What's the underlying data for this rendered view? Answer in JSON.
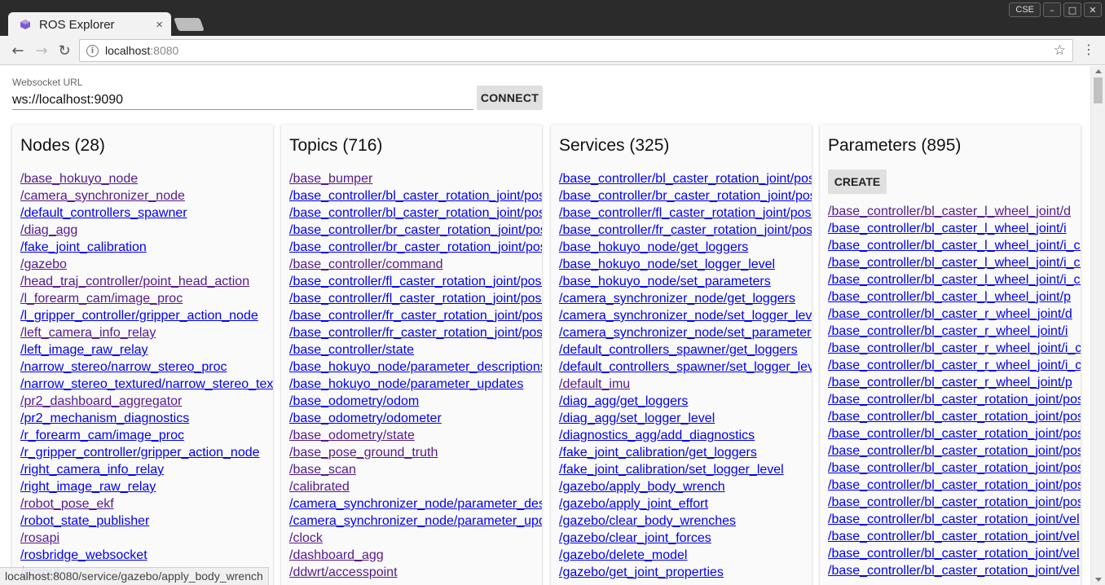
{
  "browser": {
    "tab_title": "ROS Explorer",
    "tab_close": "×",
    "win_cse": "CSE",
    "win_minimize": "–",
    "win_maximize": "□",
    "win_close": "✕",
    "url_host": "localhost",
    "url_port": ":8080",
    "back_icon": "←",
    "forward_icon": "→",
    "reload_icon": "↻",
    "info_icon": "i",
    "star_icon": "☆",
    "menu_icon": "⋮"
  },
  "websocket": {
    "label": "Websocket URL",
    "value": "ws://localhost:9090",
    "connect_label": "CONNECT"
  },
  "nodes": {
    "title": "Nodes (28)",
    "items": [
      {
        "text": "/base_hokuyo_node",
        "visited": true
      },
      {
        "text": "/camera_synchronizer_node",
        "visited": true
      },
      {
        "text": "/default_controllers_spawner",
        "visited": false
      },
      {
        "text": "/diag_agg",
        "visited": true
      },
      {
        "text": "/fake_joint_calibration",
        "visited": false
      },
      {
        "text": "/gazebo",
        "visited": true
      },
      {
        "text": "/head_traj_controller/point_head_action",
        "visited": true
      },
      {
        "text": "/l_forearm_cam/image_proc",
        "visited": true
      },
      {
        "text": "/l_gripper_controller/gripper_action_node",
        "visited": false
      },
      {
        "text": "/left_camera_info_relay",
        "visited": true
      },
      {
        "text": "/left_image_raw_relay",
        "visited": false
      },
      {
        "text": "/narrow_stereo/narrow_stereo_proc",
        "visited": false
      },
      {
        "text": "/narrow_stereo_textured/narrow_stereo_textured_proc",
        "visited": false
      },
      {
        "text": "/pr2_dashboard_aggregator",
        "visited": true
      },
      {
        "text": "/pr2_mechanism_diagnostics",
        "visited": false
      },
      {
        "text": "/r_forearm_cam/image_proc",
        "visited": false
      },
      {
        "text": "/r_gripper_controller/gripper_action_node",
        "visited": false
      },
      {
        "text": "/right_camera_info_relay",
        "visited": false
      },
      {
        "text": "/right_image_raw_relay",
        "visited": false
      },
      {
        "text": "/robot_pose_ekf",
        "visited": true
      },
      {
        "text": "/robot_state_publisher",
        "visited": false
      },
      {
        "text": "/rosapi",
        "visited": true
      },
      {
        "text": "/rosbridge_websocket",
        "visited": false
      },
      {
        "text": "/rosout",
        "visited": false
      }
    ]
  },
  "topics": {
    "title": "Topics (716)",
    "items": [
      {
        "text": "/base_bumper",
        "visited": true
      },
      {
        "text": "/base_controller/bl_caster_rotation_joint/pose",
        "visited": false
      },
      {
        "text": "/base_controller/bl_caster_rotation_joint/pose",
        "visited": false
      },
      {
        "text": "/base_controller/br_caster_rotation_joint/pose",
        "visited": false
      },
      {
        "text": "/base_controller/br_caster_rotation_joint/pose",
        "visited": false
      },
      {
        "text": "/base_controller/command",
        "visited": true
      },
      {
        "text": "/base_controller/fl_caster_rotation_joint/pose",
        "visited": false
      },
      {
        "text": "/base_controller/fl_caster_rotation_joint/pose",
        "visited": false
      },
      {
        "text": "/base_controller/fr_caster_rotation_joint/pose",
        "visited": false
      },
      {
        "text": "/base_controller/fr_caster_rotation_joint/pose",
        "visited": false
      },
      {
        "text": "/base_controller/state",
        "visited": false
      },
      {
        "text": "/base_hokuyo_node/parameter_descriptions",
        "visited": false
      },
      {
        "text": "/base_hokuyo_node/parameter_updates",
        "visited": false
      },
      {
        "text": "/base_odometry/odom",
        "visited": false
      },
      {
        "text": "/base_odometry/odometer",
        "visited": false
      },
      {
        "text": "/base_odometry/state",
        "visited": true
      },
      {
        "text": "/base_pose_ground_truth",
        "visited": true
      },
      {
        "text": "/base_scan",
        "visited": true
      },
      {
        "text": "/calibrated",
        "visited": true
      },
      {
        "text": "/camera_synchronizer_node/parameter_descriptions",
        "visited": false
      },
      {
        "text": "/camera_synchronizer_node/parameter_updates",
        "visited": false
      },
      {
        "text": "/clock",
        "visited": true
      },
      {
        "text": "/dashboard_agg",
        "visited": true
      },
      {
        "text": "/ddwrt/accesspoint",
        "visited": true
      }
    ]
  },
  "services": {
    "title": "Services (325)",
    "items": [
      {
        "text": "/base_controller/bl_caster_rotation_joint/pose",
        "visited": false
      },
      {
        "text": "/base_controller/br_caster_rotation_joint/pose",
        "visited": false
      },
      {
        "text": "/base_controller/fl_caster_rotation_joint/pose",
        "visited": false
      },
      {
        "text": "/base_controller/fr_caster_rotation_joint/pose",
        "visited": false
      },
      {
        "text": "/base_hokuyo_node/get_loggers",
        "visited": false
      },
      {
        "text": "/base_hokuyo_node/set_logger_level",
        "visited": false
      },
      {
        "text": "/base_hokuyo_node/set_parameters",
        "visited": false
      },
      {
        "text": "/camera_synchronizer_node/get_loggers",
        "visited": false
      },
      {
        "text": "/camera_synchronizer_node/set_logger_level",
        "visited": false
      },
      {
        "text": "/camera_synchronizer_node/set_parameters",
        "visited": false
      },
      {
        "text": "/default_controllers_spawner/get_loggers",
        "visited": false
      },
      {
        "text": "/default_controllers_spawner/set_logger_level",
        "visited": false
      },
      {
        "text": "/default_imu",
        "visited": true
      },
      {
        "text": "/diag_agg/get_loggers",
        "visited": false
      },
      {
        "text": "/diag_agg/set_logger_level",
        "visited": false
      },
      {
        "text": "/diagnostics_agg/add_diagnostics",
        "visited": false
      },
      {
        "text": "/fake_joint_calibration/get_loggers",
        "visited": false
      },
      {
        "text": "/fake_joint_calibration/set_logger_level",
        "visited": false
      },
      {
        "text": "/gazebo/apply_body_wrench",
        "visited": false
      },
      {
        "text": "/gazebo/apply_joint_effort",
        "visited": false
      },
      {
        "text": "/gazebo/clear_body_wrenches",
        "visited": false
      },
      {
        "text": "/gazebo/clear_joint_forces",
        "visited": false
      },
      {
        "text": "/gazebo/delete_model",
        "visited": false
      },
      {
        "text": "/gazebo/get_joint_properties",
        "visited": false
      }
    ]
  },
  "parameters": {
    "title": "Parameters (895)",
    "create_label": "CREATE",
    "items": [
      {
        "text": "/base_controller/bl_caster_l_wheel_joint/d",
        "visited": true
      },
      {
        "text": "/base_controller/bl_caster_l_wheel_joint/i",
        "visited": false
      },
      {
        "text": "/base_controller/bl_caster_l_wheel_joint/i_clamp",
        "visited": false
      },
      {
        "text": "/base_controller/bl_caster_l_wheel_joint/i_clamp",
        "visited": false
      },
      {
        "text": "/base_controller/bl_caster_l_wheel_joint/i_clamp",
        "visited": false
      },
      {
        "text": "/base_controller/bl_caster_l_wheel_joint/p",
        "visited": false
      },
      {
        "text": "/base_controller/bl_caster_r_wheel_joint/d",
        "visited": false
      },
      {
        "text": "/base_controller/bl_caster_r_wheel_joint/i",
        "visited": false
      },
      {
        "text": "/base_controller/bl_caster_r_wheel_joint/i_clamp",
        "visited": false
      },
      {
        "text": "/base_controller/bl_caster_r_wheel_joint/i_clamp",
        "visited": false
      },
      {
        "text": "/base_controller/bl_caster_r_wheel_joint/p",
        "visited": false
      },
      {
        "text": "/base_controller/bl_caster_rotation_joint/pos",
        "visited": false
      },
      {
        "text": "/base_controller/bl_caster_rotation_joint/pos",
        "visited": false
      },
      {
        "text": "/base_controller/bl_caster_rotation_joint/pos",
        "visited": false
      },
      {
        "text": "/base_controller/bl_caster_rotation_joint/pos",
        "visited": false
      },
      {
        "text": "/base_controller/bl_caster_rotation_joint/pos",
        "visited": false
      },
      {
        "text": "/base_controller/bl_caster_rotation_joint/pos",
        "visited": false
      },
      {
        "text": "/base_controller/bl_caster_rotation_joint/pos",
        "visited": false
      },
      {
        "text": "/base_controller/bl_caster_rotation_joint/vel",
        "visited": false
      },
      {
        "text": "/base_controller/bl_caster_rotation_joint/vel",
        "visited": false
      },
      {
        "text": "/base_controller/bl_caster_rotation_joint/vel",
        "visited": false
      },
      {
        "text": "/base_controller/bl_caster_rotation_joint/vel",
        "visited": false
      }
    ]
  },
  "status_bar": {
    "text": "localhost:8080/service/gazebo/apply_body_wrench"
  },
  "colors": {
    "link_visited": "#551a8b",
    "link_new": "#0000ee",
    "chrome_dark": "#2b2b2b",
    "button_gray": "#e0e0e0"
  }
}
